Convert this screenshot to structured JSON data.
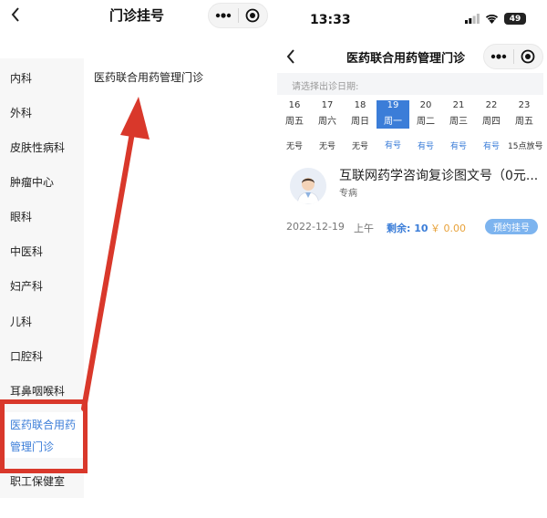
{
  "left": {
    "nav_title": "门诊挂号",
    "sidebar": [
      {
        "label": "内科"
      },
      {
        "label": "外科"
      },
      {
        "label": "皮肤性病科"
      },
      {
        "label": "肿瘤中心"
      },
      {
        "label": "眼科"
      },
      {
        "label": "中医科"
      },
      {
        "label": "妇产科"
      },
      {
        "label": "儿科"
      },
      {
        "label": "口腔科"
      },
      {
        "label": "耳鼻咽喉科"
      },
      {
        "label_line1": "医药联合用药",
        "label_line2": "管理门诊"
      },
      {
        "label": "职工保健室"
      }
    ],
    "content_item": "医药联合用药管理门诊"
  },
  "right": {
    "status_time": "13:33",
    "battery": "49",
    "nav_title": "医药联合用药管理门诊",
    "date_hint": "请选择出诊日期:",
    "dates": [
      {
        "day": "16",
        "weekday": "周五",
        "status": "无号"
      },
      {
        "day": "17",
        "weekday": "周六",
        "status": "无号"
      },
      {
        "day": "18",
        "weekday": "周日",
        "status": "无号"
      },
      {
        "day": "19",
        "weekday": "周一",
        "status": "有号"
      },
      {
        "day": "20",
        "weekday": "周二",
        "status": "有号"
      },
      {
        "day": "21",
        "weekday": "周三",
        "status": "有号"
      },
      {
        "day": "22",
        "weekday": "周四",
        "status": "有号"
      },
      {
        "day": "23",
        "weekday": "周五",
        "status": "15点放号"
      }
    ],
    "selected_date_index": 3,
    "doctor": {
      "name": "互联网药学咨询复诊图文号（0元...",
      "tag": "专病"
    },
    "slot": {
      "date": "2022-12-19",
      "period": "上午",
      "remaining": "剩余: 10",
      "price": "￥ 0.00",
      "book_label": "预约挂号"
    }
  },
  "colors": {
    "accent": "#3b7dd8",
    "highlight_red": "#d9382b",
    "price_orange": "#e8a23a",
    "book_button": "#7db4ef"
  }
}
